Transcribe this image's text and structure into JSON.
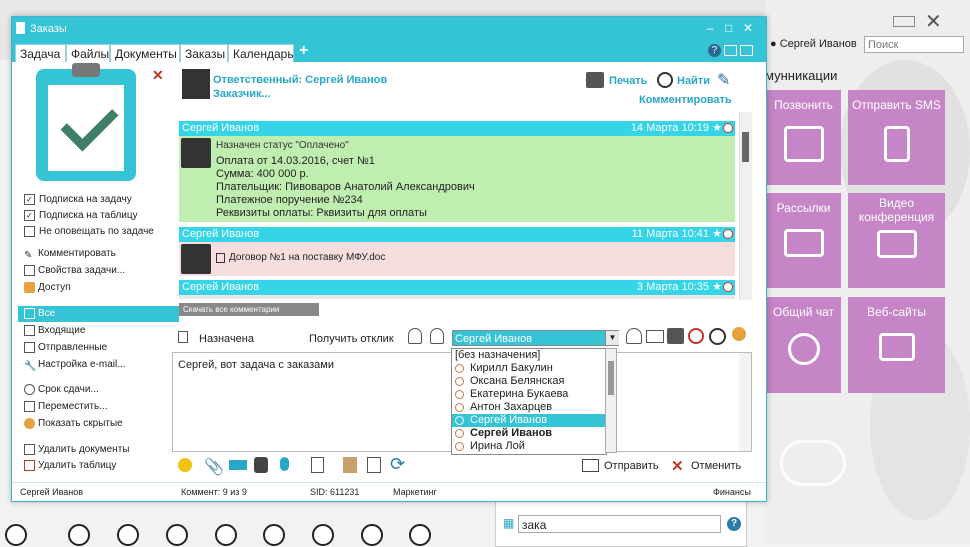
{
  "window": {
    "title": "Заказы",
    "controls": [
      "–",
      "□",
      "✕"
    ]
  },
  "tabs": [
    {
      "label": "Задача",
      "active": true
    },
    {
      "label": "Файлы"
    },
    {
      "label": "Документы"
    },
    {
      "label": "Заказы"
    },
    {
      "label": "Календарь"
    },
    {
      "label": "+"
    }
  ],
  "left": {
    "checkboxes": [
      {
        "label": "Подписка на задачу",
        "checked": true
      },
      {
        "label": "Подписка на таблицу",
        "checked": true
      },
      {
        "label": "Не оповещать по задаче",
        "checked": false
      }
    ],
    "actions": [
      "Комментировать",
      "Свойства задачи...",
      "Доступ"
    ],
    "filters": [
      {
        "label": "Все",
        "selected": true
      },
      {
        "label": "Входящие"
      },
      {
        "label": "Отправленные"
      },
      {
        "label": "Настройка e-mail..."
      }
    ],
    "more": [
      "Срок сдачи...",
      "Переместить...",
      "Показать скрытые"
    ],
    "delete": [
      "Удалить документы",
      "Удалить таблицу"
    ]
  },
  "header": {
    "responsible": "Ответственный: Сергей Иванов",
    "customer": "Заказчик...",
    "print": "Печать",
    "find": "Найти",
    "comment": "Комментировать"
  },
  "messages": [
    {
      "author": "Сергей Иванов",
      "date": "14 Марта 10:19",
      "status": "Назначен статус \"Оплачено\"",
      "lines": [
        "Оплата от 14.03.2016, счет №1",
        "Сумма: 400 000 р.",
        "Плательщик: Пивоваров Анатолий Александрович",
        "Платежное поручение №234",
        "Реквизиты оплаты: Рквизиты для оплаты"
      ]
    },
    {
      "author": "Сергей Иванов",
      "date": "11 Марта 10:41",
      "lines": [
        "Договор №1 на поставку МФУ.doc"
      ]
    },
    {
      "author": "Сергей Иванов",
      "date": "3 Марта 10:35",
      "lines": []
    }
  ],
  "download_all": "Скачать все комментарии",
  "assign": {
    "label": "Назначена",
    "get_response": "Получить отклик",
    "selected": "Сергей Иванов",
    "options": [
      "[без назначения]",
      "Кирилл Бакулин",
      "Оксана Белянская",
      "Екатерина Букаева",
      "Антон Захарцев",
      "Сергей Иванов",
      "Сергей Иванов",
      "Ирина Лой"
    ]
  },
  "compose": {
    "text": "Сергей, вот задача с заказами",
    "send": "Отправить",
    "cancel": "Отменить"
  },
  "statusbar": {
    "user": "Сергей Иванов",
    "comments": "Коммент: 9 из 9",
    "sid": "SID: 611231",
    "dept": "Маркетинг",
    "finance": "Финансы"
  },
  "background": {
    "user": "Сергей Иванов",
    "search_placeholder": "Поиск",
    "section": "мунникации",
    "tiles": [
      {
        "label": "Позвонить"
      },
      {
        "label": "Отправить SMS"
      },
      {
        "label": "Рассылки"
      },
      {
        "label": "Видео конференция"
      },
      {
        "label": "Общий чат"
      },
      {
        "label": "Веб-сайты"
      }
    ],
    "bottom_search": "зака"
  },
  "colors": {
    "accent": "#35c3d6",
    "tile": "#c685c6",
    "msg_green": "#bfeeb0",
    "msg_pink": "#f6dede"
  }
}
